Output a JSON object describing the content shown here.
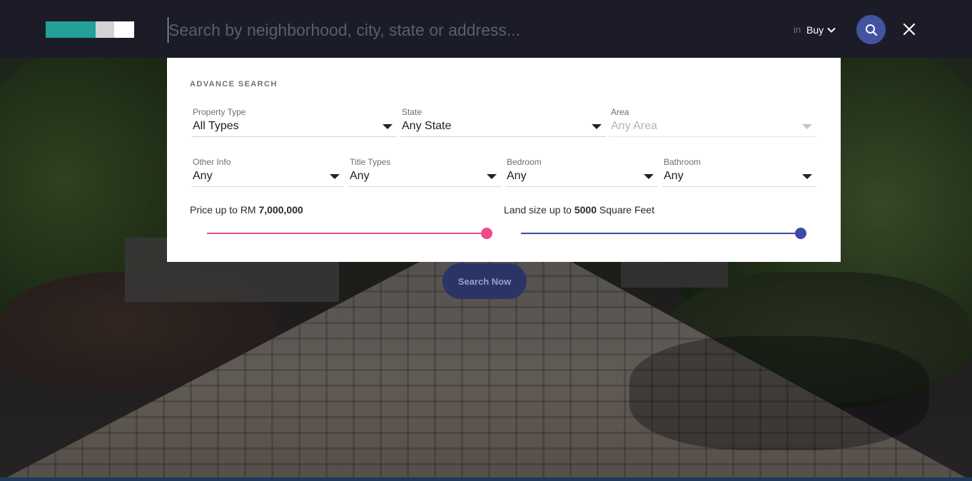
{
  "header": {
    "search_placeholder": "Search by neighborhood, city, state or address...",
    "in_label": "in",
    "mode": "Buy",
    "accent": "#4453a0"
  },
  "advance_search": {
    "title": "ADVANCE SEARCH",
    "fields_row1": [
      {
        "label": "Property Type",
        "value": "All Types"
      },
      {
        "label": "State",
        "value": "Any State"
      },
      {
        "label": "Area",
        "value": "Any Area",
        "disabled": true
      }
    ],
    "fields_row2": [
      {
        "label": "Other Info",
        "value": "Any"
      },
      {
        "label": "Title Types",
        "value": "Any"
      },
      {
        "label": "Bedroom",
        "value": "Any"
      },
      {
        "label": "Bathroom",
        "value": "Any"
      }
    ],
    "price": {
      "prefix": "Price up to RM ",
      "value": "7,000,000",
      "suffix": "",
      "level": 1.0,
      "color": "#ee4b8a"
    },
    "land": {
      "prefix": "Land size up to ",
      "value": "5000",
      "suffix": " Square Feet",
      "level": 1.0,
      "color": "#3f4aa6"
    }
  },
  "search_now_label": "Search Now"
}
